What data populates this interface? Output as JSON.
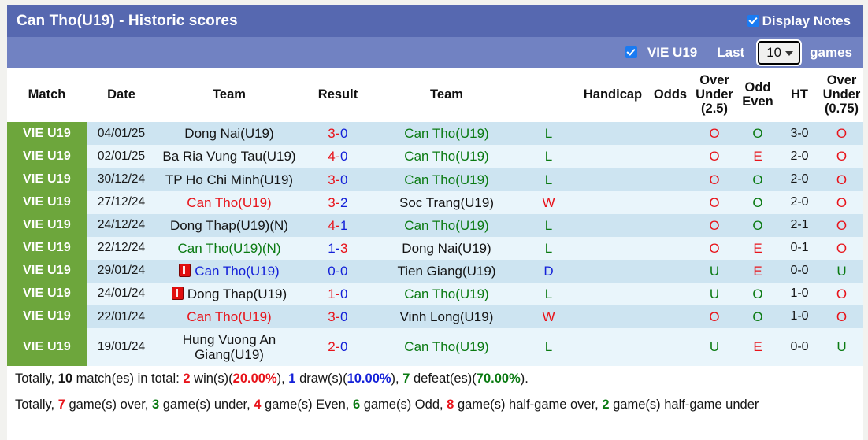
{
  "header": {
    "title": "Can Tho(U19) - Historic scores",
    "display_notes_label": "Display Notes",
    "display_notes_checked": true,
    "league_filter_label": "VIE U19",
    "league_filter_checked": true,
    "last_label": "Last",
    "games_label": "games",
    "last_count_value": "10",
    "bar_color": "#5668b0",
    "subbar_color": "#7182c2"
  },
  "table": {
    "columns": [
      {
        "label": "Match"
      },
      {
        "label": "Date"
      },
      {
        "label": "Team"
      },
      {
        "label": "Result"
      },
      {
        "label": "Team"
      },
      {
        "label": ""
      },
      {
        "label": "Handicap"
      },
      {
        "label": "Odds"
      },
      {
        "label": "Over\nUnder\n(2.5)",
        "line1": "Over",
        "line2": "Under",
        "line3": "(2.5)"
      },
      {
        "label": "Odd\nEven",
        "line1": "Odd",
        "line2": "Even"
      },
      {
        "label": "HT"
      },
      {
        "label": "Over\nUnder\n(0.75)",
        "line1": "Over",
        "line2": "Under",
        "line3": "(0.75)"
      }
    ],
    "rows": [
      {
        "league": "VIE U19",
        "date": "04/01/25",
        "home": "Dong Nai(U19)",
        "home_color": "black",
        "home_card": false,
        "score_home": "3",
        "score_away": "0",
        "score_home_color": "red",
        "score_away_color": "blue",
        "away": "Can Tho(U19)",
        "away_color": "green",
        "away_card": false,
        "wl": "L",
        "wl_color": "green",
        "handicap": "",
        "odds": "",
        "ou": "O",
        "ou_color": "red",
        "oe": "O",
        "oe_color": "green",
        "ht": "3-0",
        "ou75": "O",
        "ou75_color": "red"
      },
      {
        "league": "VIE U19",
        "date": "02/01/25",
        "home": "Ba Ria Vung Tau(U19)",
        "home_color": "black",
        "home_card": false,
        "score_home": "4",
        "score_away": "0",
        "score_home_color": "red",
        "score_away_color": "blue",
        "away": "Can Tho(U19)",
        "away_color": "green",
        "away_card": false,
        "wl": "L",
        "wl_color": "green",
        "handicap": "",
        "odds": "",
        "ou": "O",
        "ou_color": "red",
        "oe": "E",
        "oe_color": "red",
        "ht": "2-0",
        "ou75": "O",
        "ou75_color": "red"
      },
      {
        "league": "VIE U19",
        "date": "30/12/24",
        "home": "TP Ho Chi Minh(U19)",
        "home_color": "black",
        "home_card": false,
        "score_home": "3",
        "score_away": "0",
        "score_home_color": "red",
        "score_away_color": "blue",
        "away": "Can Tho(U19)",
        "away_color": "green",
        "away_card": false,
        "wl": "L",
        "wl_color": "green",
        "handicap": "",
        "odds": "",
        "ou": "O",
        "ou_color": "red",
        "oe": "O",
        "oe_color": "green",
        "ht": "2-0",
        "ou75": "O",
        "ou75_color": "red"
      },
      {
        "league": "VIE U19",
        "date": "27/12/24",
        "home": "Can Tho(U19)",
        "home_color": "red",
        "home_card": false,
        "score_home": "3",
        "score_away": "2",
        "score_home_color": "red",
        "score_away_color": "blue",
        "away": "Soc Trang(U19)",
        "away_color": "black",
        "away_card": false,
        "wl": "W",
        "wl_color": "red",
        "handicap": "",
        "odds": "",
        "ou": "O",
        "ou_color": "red",
        "oe": "O",
        "oe_color": "green",
        "ht": "2-0",
        "ou75": "O",
        "ou75_color": "red"
      },
      {
        "league": "VIE U19",
        "date": "24/12/24",
        "home": "Dong Thap(U19)(N)",
        "home_color": "black",
        "home_card": false,
        "score_home": "4",
        "score_away": "1",
        "score_home_color": "red",
        "score_away_color": "blue",
        "away": "Can Tho(U19)",
        "away_color": "green",
        "away_card": false,
        "wl": "L",
        "wl_color": "green",
        "handicap": "",
        "odds": "",
        "ou": "O",
        "ou_color": "red",
        "oe": "O",
        "oe_color": "green",
        "ht": "2-1",
        "ou75": "O",
        "ou75_color": "red"
      },
      {
        "league": "VIE U19",
        "date": "22/12/24",
        "home": "Can Tho(U19)(N)",
        "home_color": "green",
        "home_card": false,
        "score_home": "1",
        "score_away": "3",
        "score_home_color": "blue",
        "score_away_color": "red",
        "away": "Dong Nai(U19)",
        "away_color": "black",
        "away_card": false,
        "wl": "L",
        "wl_color": "green",
        "handicap": "",
        "odds": "",
        "ou": "O",
        "ou_color": "red",
        "oe": "E",
        "oe_color": "red",
        "ht": "0-1",
        "ou75": "O",
        "ou75_color": "red"
      },
      {
        "league": "VIE U19",
        "date": "29/01/24",
        "home": "Can Tho(U19)",
        "home_color": "blue",
        "home_card": true,
        "score_home": "0",
        "score_away": "0",
        "score_home_color": "blue",
        "score_away_color": "blue",
        "away": "Tien Giang(U19)",
        "away_color": "black",
        "away_card": false,
        "wl": "D",
        "wl_color": "blue",
        "handicap": "",
        "odds": "",
        "ou": "U",
        "ou_color": "green",
        "oe": "E",
        "oe_color": "red",
        "ht": "0-0",
        "ou75": "U",
        "ou75_color": "green"
      },
      {
        "league": "VIE U19",
        "date": "24/01/24",
        "home": "Dong Thap(U19)",
        "home_color": "black",
        "home_card": true,
        "score_home": "1",
        "score_away": "0",
        "score_home_color": "red",
        "score_away_color": "blue",
        "away": "Can Tho(U19)",
        "away_color": "green",
        "away_card": false,
        "wl": "L",
        "wl_color": "green",
        "handicap": "",
        "odds": "",
        "ou": "U",
        "ou_color": "green",
        "oe": "O",
        "oe_color": "green",
        "ht": "1-0",
        "ou75": "O",
        "ou75_color": "red"
      },
      {
        "league": "VIE U19",
        "date": "22/01/24",
        "home": "Can Tho(U19)",
        "home_color": "red",
        "home_card": false,
        "score_home": "3",
        "score_away": "0",
        "score_home_color": "red",
        "score_away_color": "blue",
        "away": "Vinh Long(U19)",
        "away_color": "black",
        "away_card": false,
        "wl": "W",
        "wl_color": "red",
        "handicap": "",
        "odds": "",
        "ou": "O",
        "ou_color": "red",
        "oe": "O",
        "oe_color": "green",
        "ht": "1-0",
        "ou75": "O",
        "ou75_color": "red"
      },
      {
        "league": "VIE U19",
        "date": "19/01/24",
        "home": "Hung Vuong An Giang(U19)",
        "home_color": "black",
        "home_card": false,
        "score_home": "2",
        "score_away": "0",
        "score_home_color": "red",
        "score_away_color": "blue",
        "away": "Can Tho(U19)",
        "away_color": "green",
        "away_card": false,
        "wl": "L",
        "wl_color": "green",
        "handicap": "",
        "odds": "",
        "ou": "U",
        "ou_color": "green",
        "oe": "E",
        "oe_color": "red",
        "ht": "0-0",
        "ou75": "U",
        "ou75_color": "green"
      }
    ]
  },
  "footer": {
    "line1": {
      "t1": "Totally, ",
      "n1": "10",
      "t2": " match(es) in total: ",
      "n2": "2",
      "t3": " win(s)(",
      "p1": "20.00%",
      "t4": "), ",
      "n3": "1",
      "t5": " draw(s)(",
      "p2": "10.00%",
      "t6": "), ",
      "n4": "7",
      "t7": " defeat(es)(",
      "p3": "70.00%",
      "t8": ")."
    },
    "line2": {
      "t1": "Totally, ",
      "n1": "7",
      "t2": " game(s) over, ",
      "n2": "3",
      "t3": " game(s) under, ",
      "n3": "4",
      "t4": " game(s) Even, ",
      "n4": "6",
      "t5": " game(s) Odd, ",
      "n5": "8",
      "t6": " game(s) half-game over, ",
      "n6": "2",
      "t7": " game(s) half-game under"
    }
  },
  "colors": {
    "win_red": "#e8131a",
    "loss_green": "#0a7a12",
    "draw_blue": "#1320d8",
    "league_green": "#6da63c",
    "header_blue": "#5668b0",
    "row_odd": "#cde4f1",
    "row_even": "#e9f5fb"
  }
}
